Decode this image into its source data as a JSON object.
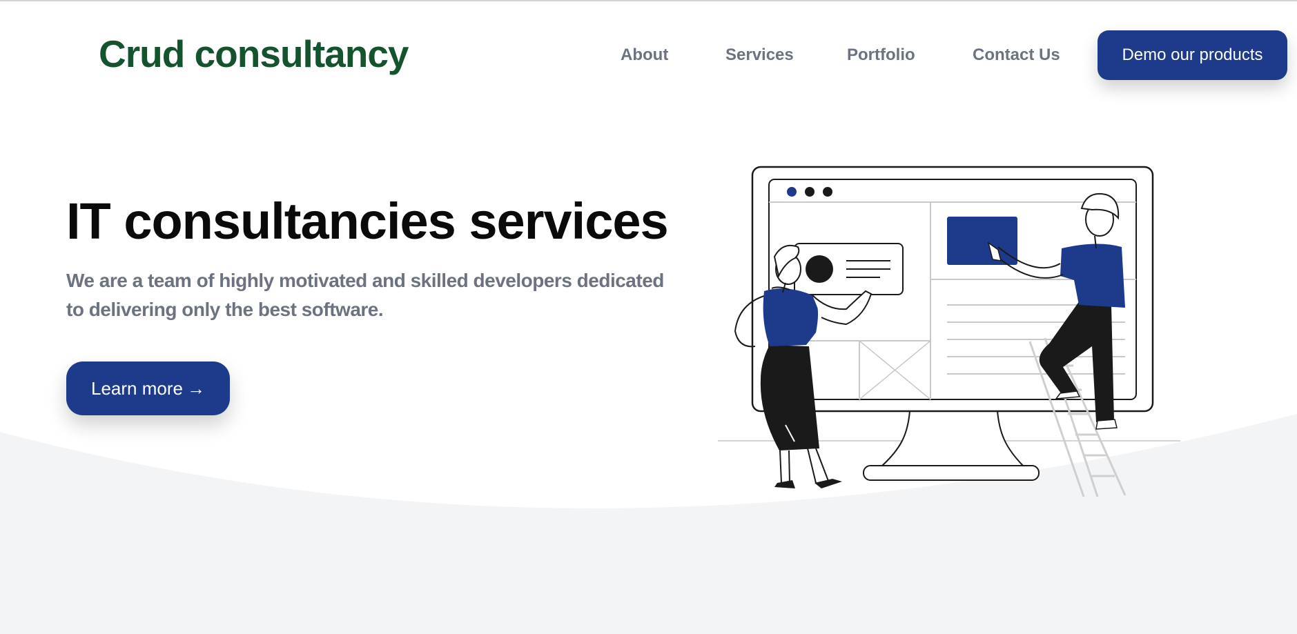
{
  "header": {
    "brand": "Crud consultancy",
    "nav": [
      {
        "label": "About"
      },
      {
        "label": "Services"
      },
      {
        "label": "Portfolio"
      },
      {
        "label": "Contact Us"
      }
    ],
    "cta_label": "Demo our products"
  },
  "hero": {
    "title": "IT consultancies services",
    "description": "We are a team of highly motivated and skilled developers dedicated to delivering only the best software.",
    "button_label": "Learn more",
    "button_icon": "arrow-right-icon",
    "button_arrow": "→"
  },
  "illustration": {
    "subject": "team-building-website-illustration"
  },
  "colors": {
    "brand_green": "#14532d",
    "accent_blue": "#1e3a8a",
    "muted_text": "#6b7280",
    "section_gray": "#f3f4f6"
  }
}
